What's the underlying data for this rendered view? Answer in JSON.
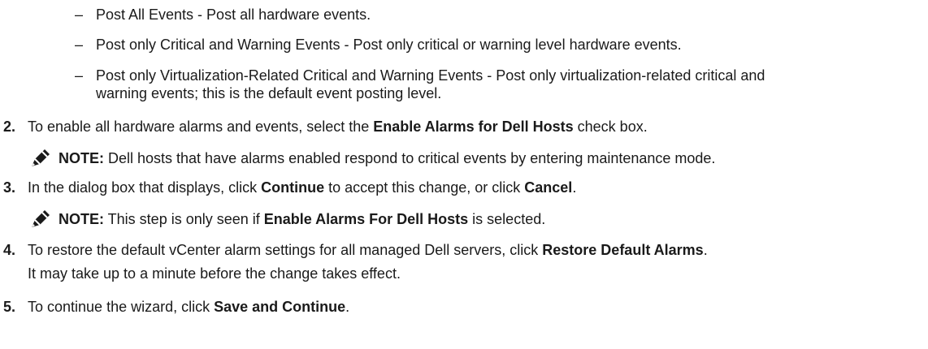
{
  "bullets": [
    "Post All Events - Post all hardware events.",
    "Post only Critical and Warning Events - Post only critical or warning level hardware events.",
    "Post only Virtualization-Related Critical and Warning Events - Post only virtualization-related critical and",
    "warning events; this is the default event posting level."
  ],
  "dash_glyph": "–",
  "step2": {
    "number": "2.",
    "pre": "To enable all hardware alarms and events, select the ",
    "bold": "Enable Alarms for Dell Hosts",
    "post": " check box."
  },
  "note1": {
    "icon": "pencil-note-icon",
    "label": "NOTE:",
    "text": " Dell hosts that have alarms enabled respond to critical events by entering maintenance mode."
  },
  "step3": {
    "number": "3.",
    "pre": "In the dialog box that displays, click ",
    "bold1": "Continue",
    "mid": " to accept this change, or click ",
    "bold2": "Cancel",
    "post": "."
  },
  "note2": {
    "icon": "pencil-note-icon",
    "label": "NOTE:",
    "pre": " This step is only seen if ",
    "bold": "Enable Alarms For Dell Hosts",
    "post": " is selected."
  },
  "step4": {
    "number": "4.",
    "pre": "To restore the default vCenter alarm settings for all managed Dell servers, click ",
    "bold": "Restore Default Alarms",
    "post": ".",
    "line2": "It may take up to a minute before the change takes effect."
  },
  "step5": {
    "number": "5.",
    "pre": "To continue the wizard, click ",
    "bold": "Save and Continue",
    "post": "."
  }
}
